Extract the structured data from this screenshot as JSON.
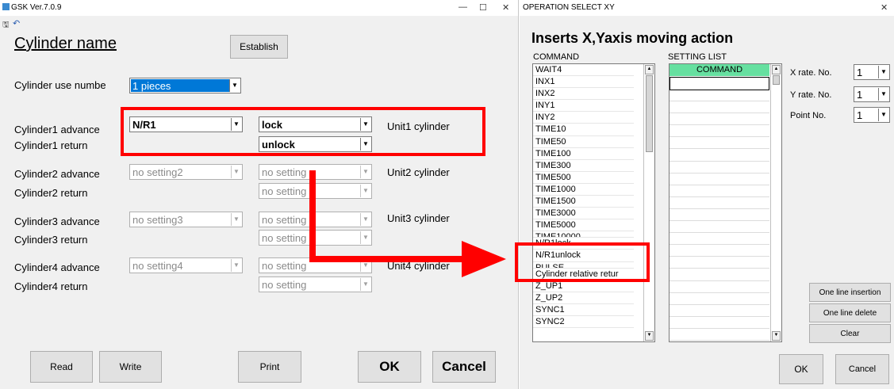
{
  "window1": {
    "title": "GSK Ver.7.0.9",
    "header_title": "Cylinder name",
    "establish_button": "Establish",
    "cylinder_use_label": "Cylinder  use numbe",
    "cylinder_use_value": "1 pieces",
    "rows": [
      {
        "advance_label": "Cylinder1 advance",
        "return_label": "Cylinder1 return",
        "advance_value": "N/R1",
        "adv_cmd": "lock",
        "ret_cmd": "unlock",
        "unit": "Unit1 cylinder"
      },
      {
        "advance_label": "Cylinder2 advance",
        "return_label": "Cylinder2 return",
        "advance_value": "no setting2",
        "adv_cmd": "no setting",
        "ret_cmd": "no setting",
        "unit": "Unit2 cylinder"
      },
      {
        "advance_label": "Cylinder3 advance",
        "return_label": "Cylinder3 return",
        "advance_value": "no setting3",
        "adv_cmd": "no setting",
        "ret_cmd": "no setting",
        "unit": "Unit3 cylinder"
      },
      {
        "advance_label": "Cylinder4 advance",
        "return_label": "Cylinder4 return",
        "advance_value": "no setting4",
        "adv_cmd": "no setting",
        "ret_cmd": "no setting",
        "unit": "Unit4 cylinder"
      }
    ],
    "buttons": {
      "read": "Read",
      "write": "Write",
      "print": "Print",
      "ok": "OK",
      "cancel": "Cancel"
    }
  },
  "window2": {
    "title": "OPERATION SELECT XY",
    "header_title": "Inserts X,Yaxis moving action",
    "command_label": "COMMAND",
    "setting_list_label": "SETTING LIST",
    "setting_header": "COMMAND",
    "commands": [
      "WAIT4",
      "INX1",
      "INX2",
      "INY1",
      "INY2",
      "TIME10",
      "TIME50",
      "TIME100",
      "TIME300",
      "TIME500",
      "TIME1000",
      "TIME1500",
      "TIME3000",
      "TIME5000",
      "TIME10000",
      "N/R1lock",
      "N/R1unlock",
      "PULSE",
      "Cylinder relative retur",
      "Z_UP1",
      "Z_UP2",
      "SYNC1",
      "SYNC2"
    ],
    "x_rate_label": "X rate. No.",
    "y_rate_label": "Y rate. No.",
    "point_label": "Point No.",
    "x_rate_value": "1",
    "y_rate_value": "1",
    "point_value": "1",
    "one_line_insertion": "One line insertion",
    "one_line_delete": "One line delete",
    "clear": "Clear",
    "ok": "OK",
    "cancel": "Cancel"
  },
  "colors": {
    "highlight_red": "#ff0000",
    "selection_blue": "#0078d7",
    "list_header_green": "#66e0a0",
    "scroll_blue": "#9fbfe6"
  }
}
